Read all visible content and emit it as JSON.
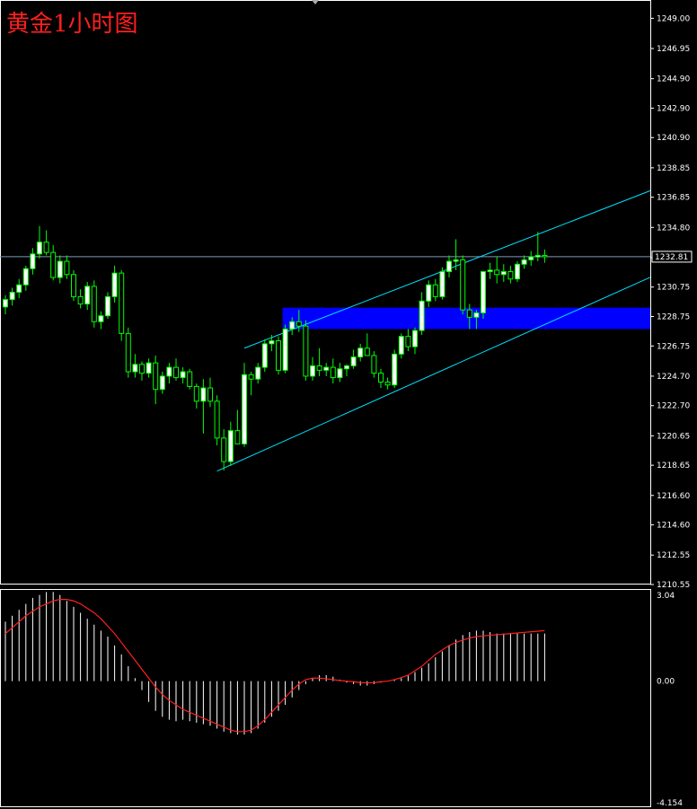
{
  "title": "黄金1小时图",
  "colors": {
    "background": "#000000",
    "frame": "#ffffff",
    "title": "#ff1f1f",
    "bull_body": "#ffffff",
    "bear_body": "#000000",
    "wick": "#00ff00",
    "channel": "#00e0ff",
    "price_line": "#7f9ab4",
    "zone": "#0000ff",
    "macd_hist": "#ffffff",
    "signal_line": "#ff2020"
  },
  "chart_data": [
    {
      "type": "candlestick",
      "name": "price",
      "yaxis_ticks": [
        "1249.00",
        "1246.95",
        "1244.90",
        "1242.90",
        "1240.90",
        "1238.85",
        "1236.85",
        "1234.80",
        "1232.75",
        "1230.75",
        "1228.75",
        "1226.75",
        "1224.70",
        "1222.70",
        "1220.65",
        "1218.65",
        "1216.60",
        "1214.60",
        "1212.55",
        "1210.55"
      ],
      "ylim": [
        1210.55,
        1250.0
      ],
      "current_price": "1232.81",
      "resistance_zone": [
        1227.9,
        1229.35
      ],
      "channel": {
        "upper": [
          [
            35,
            1226.6
          ],
          [
            92,
            1236.85
          ]
        ],
        "lower": [
          [
            31,
            1218.25
          ],
          [
            92,
            1230.9
          ]
        ]
      },
      "candles": [
        [
          1229.4,
          1230.2,
          1228.9,
          1229.9
        ],
        [
          1229.9,
          1230.7,
          1229.5,
          1230.4
        ],
        [
          1230.4,
          1231.3,
          1230.0,
          1230.9
        ],
        [
          1230.9,
          1232.2,
          1230.5,
          1232.0
        ],
        [
          1232.0,
          1233.4,
          1231.6,
          1233.0
        ],
        [
          1233.0,
          1234.9,
          1232.7,
          1233.8
        ],
        [
          1233.8,
          1234.6,
          1232.9,
          1233.1
        ],
        [
          1233.1,
          1233.6,
          1231.2,
          1231.4
        ],
        [
          1231.4,
          1232.9,
          1231.0,
          1232.5
        ],
        [
          1232.5,
          1232.9,
          1231.3,
          1231.6
        ],
        [
          1231.6,
          1231.9,
          1229.8,
          1230.1
        ],
        [
          1230.1,
          1230.6,
          1229.3,
          1229.6
        ],
        [
          1229.6,
          1231.1,
          1229.2,
          1230.8
        ],
        [
          1230.8,
          1231.2,
          1228.0,
          1228.4
        ],
        [
          1228.4,
          1229.1,
          1227.9,
          1228.8
        ],
        [
          1228.8,
          1230.4,
          1228.6,
          1230.1
        ],
        [
          1230.1,
          1232.2,
          1229.7,
          1231.7
        ],
        [
          1231.7,
          1231.9,
          1227.1,
          1227.6
        ],
        [
          1227.6,
          1228.0,
          1224.6,
          1225.0
        ],
        [
          1225.0,
          1226.2,
          1224.6,
          1225.5
        ],
        [
          1225.5,
          1225.7,
          1224.4,
          1224.9
        ],
        [
          1224.9,
          1225.9,
          1224.6,
          1225.6
        ],
        [
          1225.6,
          1226.1,
          1222.8,
          1223.8
        ],
        [
          1223.8,
          1225.0,
          1223.5,
          1224.7
        ],
        [
          1224.7,
          1225.6,
          1224.2,
          1225.3
        ],
        [
          1225.3,
          1225.9,
          1224.4,
          1224.6
        ],
        [
          1224.6,
          1225.3,
          1224.2,
          1225.0
        ],
        [
          1225.0,
          1225.2,
          1223.8,
          1224.0
        ],
        [
          1224.0,
          1224.2,
          1222.5,
          1223.0
        ],
        [
          1223.0,
          1224.5,
          1220.8,
          1223.9
        ],
        [
          1223.9,
          1224.6,
          1222.6,
          1223.0
        ],
        [
          1223.0,
          1223.4,
          1220.0,
          1220.5
        ],
        [
          1220.5,
          1221.1,
          1218.3,
          1218.9
        ],
        [
          1218.9,
          1221.6,
          1218.6,
          1221.0
        ],
        [
          1221.0,
          1222.4,
          1220.5,
          1220.1
        ],
        [
          1220.1,
          1225.6,
          1219.9,
          1224.8
        ],
        [
          1224.8,
          1225.0,
          1223.4,
          1224.5
        ],
        [
          1224.5,
          1225.6,
          1224.2,
          1225.3
        ],
        [
          1225.3,
          1227.2,
          1225.0,
          1226.9
        ],
        [
          1226.9,
          1227.5,
          1226.4,
          1227.1
        ],
        [
          1227.1,
          1227.4,
          1224.8,
          1225.1
        ],
        [
          1225.1,
          1228.2,
          1224.9,
          1227.9
        ],
        [
          1227.9,
          1228.7,
          1227.5,
          1228.4
        ],
        [
          1228.4,
          1229.2,
          1227.7,
          1228.1
        ],
        [
          1228.1,
          1228.5,
          1224.4,
          1224.7
        ],
        [
          1224.7,
          1226.0,
          1224.4,
          1225.4
        ],
        [
          1225.4,
          1226.6,
          1224.7,
          1225.1
        ],
        [
          1225.1,
          1225.6,
          1224.7,
          1225.3
        ],
        [
          1225.3,
          1225.9,
          1224.2,
          1224.6
        ],
        [
          1224.6,
          1225.6,
          1224.3,
          1225.2
        ],
        [
          1225.2,
          1225.5,
          1224.7,
          1225.4
        ],
        [
          1225.4,
          1226.5,
          1225.2,
          1226.0
        ],
        [
          1226.0,
          1226.9,
          1225.7,
          1226.6
        ],
        [
          1226.6,
          1227.6,
          1226.1,
          1226.1
        ],
        [
          1226.1,
          1226.4,
          1224.6,
          1224.9
        ],
        [
          1224.9,
          1225.2,
          1223.9,
          1224.3
        ],
        [
          1224.3,
          1224.6,
          1223.8,
          1224.1
        ],
        [
          1224.1,
          1226.5,
          1223.9,
          1226.2
        ],
        [
          1226.2,
          1227.6,
          1225.9,
          1227.4
        ],
        [
          1227.4,
          1227.9,
          1226.4,
          1226.7
        ],
        [
          1226.7,
          1228.0,
          1226.2,
          1227.8
        ],
        [
          1227.8,
          1230.4,
          1227.5,
          1229.8
        ],
        [
          1229.8,
          1231.2,
          1229.4,
          1230.9
        ],
        [
          1230.9,
          1231.3,
          1229.8,
          1230.1
        ],
        [
          1230.1,
          1232.1,
          1229.9,
          1231.8
        ],
        [
          1231.8,
          1232.9,
          1231.4,
          1232.5
        ],
        [
          1232.5,
          1234.0,
          1231.9,
          1232.6
        ],
        [
          1232.6,
          1232.9,
          1228.9,
          1229.2
        ],
        [
          1229.2,
          1229.6,
          1227.9,
          1228.7
        ],
        [
          1228.7,
          1229.2,
          1227.9,
          1229.0
        ],
        [
          1229.0,
          1231.7,
          1228.6,
          1231.8
        ],
        [
          1231.8,
          1232.4,
          1231.3,
          1231.9
        ],
        [
          1231.9,
          1232.8,
          1231.0,
          1231.6
        ],
        [
          1231.6,
          1232.3,
          1231.1,
          1231.8
        ],
        [
          1231.8,
          1232.2,
          1231.0,
          1231.3
        ],
        [
          1231.3,
          1232.5,
          1231.1,
          1232.3
        ],
        [
          1232.3,
          1232.9,
          1232.0,
          1232.6
        ],
        [
          1232.6,
          1233.2,
          1232.2,
          1232.8
        ],
        [
          1232.8,
          1234.5,
          1232.5,
          1232.9
        ],
        [
          1232.9,
          1233.3,
          1232.4,
          1232.81
        ]
      ]
    },
    {
      "type": "bar",
      "name": "oscillator",
      "yaxis_ticks": [
        "3.04",
        "0.00",
        "-4.154"
      ],
      "ylim": [
        -4.154,
        3.04
      ],
      "histogram": [
        2.0,
        2.2,
        2.4,
        2.6,
        2.8,
        2.9,
        3.0,
        3.0,
        2.9,
        2.7,
        2.5,
        2.3,
        2.1,
        1.9,
        1.7,
        1.5,
        1.2,
        0.9,
        0.5,
        0.1,
        -0.3,
        -0.7,
        -1.0,
        -1.2,
        -1.3,
        -1.35,
        -1.3,
        -1.35,
        -1.4,
        -1.45,
        -1.5,
        -1.6,
        -1.7,
        -1.75,
        -1.8,
        -1.8,
        -1.75,
        -1.6,
        -1.4,
        -1.2,
        -1.0,
        -0.8,
        -0.55,
        -0.3,
        -0.1,
        0.1,
        0.2,
        0.2,
        0.15,
        0.05,
        -0.05,
        -0.1,
        -0.15,
        -0.15,
        -0.1,
        -0.05,
        0.0,
        0.05,
        0.1,
        0.2,
        0.3,
        0.45,
        0.6,
        0.8,
        1.0,
        1.2,
        1.4,
        1.55,
        1.65,
        1.7,
        1.7,
        1.65,
        1.6,
        1.6,
        1.6,
        1.6,
        1.6,
        1.6,
        1.6,
        1.6
      ],
      "signal": [
        1.6,
        1.8,
        2.0,
        2.2,
        2.35,
        2.5,
        2.6,
        2.7,
        2.75,
        2.75,
        2.7,
        2.6,
        2.45,
        2.3,
        2.1,
        1.85,
        1.6,
        1.3,
        1.0,
        0.7,
        0.4,
        0.1,
        -0.2,
        -0.45,
        -0.65,
        -0.8,
        -0.95,
        -1.05,
        -1.15,
        -1.25,
        -1.35,
        -1.45,
        -1.55,
        -1.65,
        -1.7,
        -1.7,
        -1.65,
        -1.5,
        -1.3,
        -1.05,
        -0.8,
        -0.55,
        -0.3,
        -0.1,
        0.05,
        0.1,
        0.1,
        0.08,
        0.05,
        0.02,
        0.0,
        -0.02,
        -0.05,
        -0.06,
        -0.05,
        -0.02,
        0.0,
        0.05,
        0.12,
        0.2,
        0.35,
        0.5,
        0.7,
        0.9,
        1.05,
        1.2,
        1.3,
        1.38,
        1.45,
        1.5,
        1.52,
        1.55,
        1.56,
        1.58,
        1.6,
        1.62,
        1.64,
        1.66,
        1.68,
        1.7
      ]
    }
  ]
}
